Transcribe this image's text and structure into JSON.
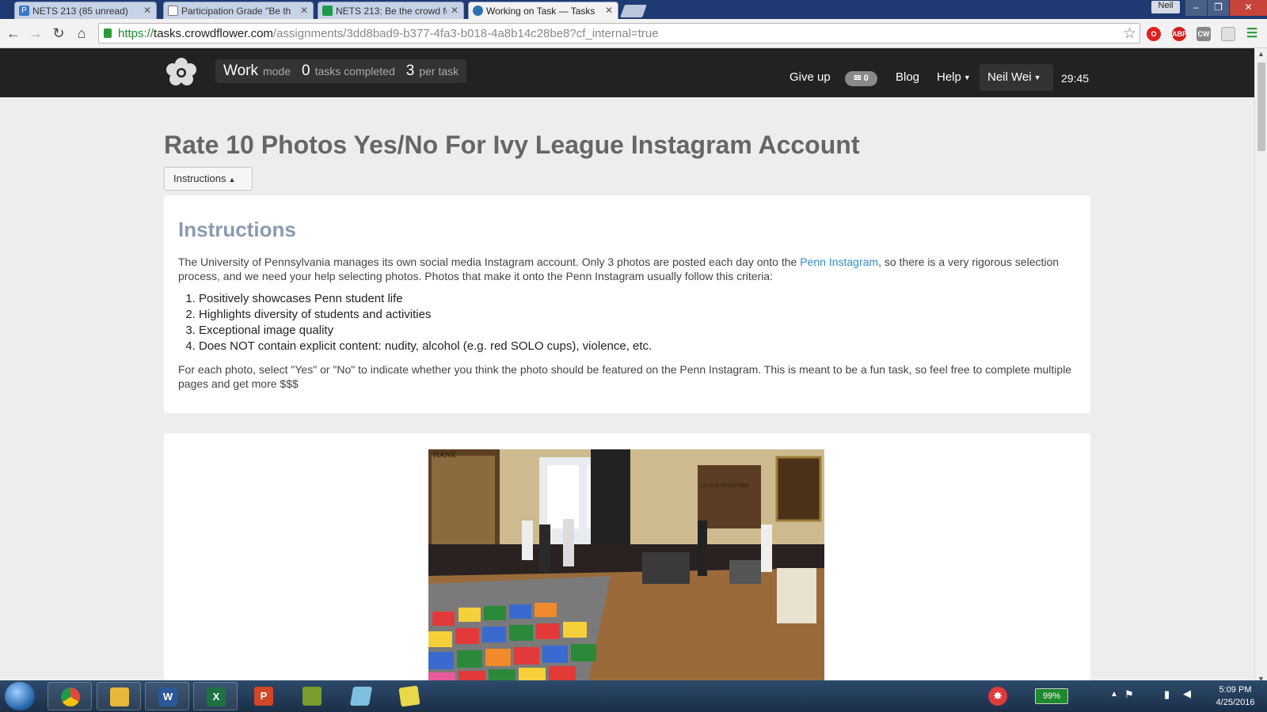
{
  "browser": {
    "tabs": [
      {
        "label": "NETS 213 (85 unread)",
        "icon_color": "#3a77c8"
      },
      {
        "label": "Participation Grade \"Be th",
        "icon_color": "#ffffff"
      },
      {
        "label": "NETS 213: Be the crowd fo",
        "icon_color": "#1e9a4a"
      },
      {
        "label": "Working on Task — Tasks",
        "icon_color": "#2f6fb0"
      }
    ],
    "window_user": "Neil",
    "url_scheme": "https://",
    "url_host": "tasks.crowdflower.com",
    "url_path": "/assignments/3dd8bad9-b377-4fa3-b018-4a8b14c28be8?cf_internal=true",
    "extensions": [
      "opera-icon",
      "abp-icon",
      "cw-icon",
      "page-icon",
      "menu-icon"
    ]
  },
  "site": {
    "mode_label": "Work",
    "mode_suffix": "mode",
    "tasks_completed_count": "0",
    "tasks_completed_label": "tasks completed",
    "per_task_count": "3",
    "per_task_label": "per task",
    "give_up": "Give up",
    "mail_count": "0",
    "blog": "Blog",
    "help": "Help",
    "user": "Neil Wei",
    "timer": "29:45"
  },
  "task": {
    "title": "Rate 10 Photos Yes/No For Ivy League Instagram Account",
    "instructions_toggle": "Instructions",
    "heading": "Instructions",
    "intro_before_link": "The University of Pennsylvania manages its own social media Instagram account. Only 3 photos are posted each day onto the ",
    "link_text": "Penn Instagram",
    "intro_after_link": ", so there is a very rigorous selection process, and we need your help selecting photos. Photos that make it onto the Penn Instagram usually follow this criteria:",
    "criteria": [
      "Positively showcases Penn student life",
      "Highlights diversity of students and activities",
      "Exceptional image quality",
      "Does NOT contain explicit content: nudity, alcohol (e.g. red SOLO cups), violence, etc."
    ],
    "closing": "For each photo, select \"Yes\" or \"No\" to indicate whether you think the photo should be featured on the Penn Instagram. This is meant to be a fun task, so feel free to complete multiple pages and get more $$$"
  },
  "photo": {
    "wall_text_left": "HANK",
    "wall_text_right": "OUR SUPPORTERS"
  },
  "taskbar": {
    "apps": [
      {
        "name": "chrome",
        "label": "",
        "color": "#e04a3a"
      },
      {
        "name": "explorer",
        "label": "",
        "color": "#e8b73a"
      },
      {
        "name": "word",
        "label": "W",
        "color": "#2b5797"
      },
      {
        "name": "excel",
        "label": "X",
        "color": "#1e7145"
      },
      {
        "name": "powerpoint",
        "label": "P",
        "color": "#d24726"
      },
      {
        "name": "notes",
        "label": "",
        "color": "#7a9c2c"
      },
      {
        "name": "paper",
        "label": "",
        "color": "#7fbfdf"
      },
      {
        "name": "sticky",
        "label": "",
        "color": "#e8d84a"
      }
    ],
    "battery": "99%",
    "time": "5:09 PM",
    "date": "4/25/2016"
  }
}
